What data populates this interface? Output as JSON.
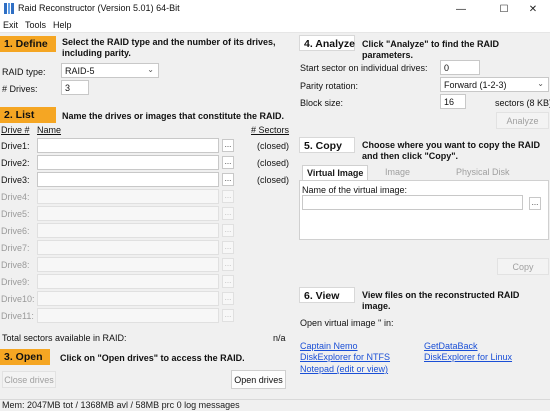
{
  "window": {
    "title": "Raid Reconstructor (Version 5.01) 64-Bit",
    "minimize": "—",
    "maximize": "☐",
    "close": "✕"
  },
  "menu": [
    "Exit",
    "Tools",
    "Help"
  ],
  "define": {
    "badge": "1. Define",
    "description": "Select the RAID type and the number of its drives, including parity.",
    "raid_type_label": "RAID type:",
    "raid_type_value": "RAID-5",
    "drives_label": "# Drives:",
    "drives_value": "3"
  },
  "list": {
    "badge": "2. List",
    "description": "Name the drives or images that constitute the RAID.",
    "col_drive": "Drive #",
    "col_name": "Name",
    "col_sectors": "# Sectors",
    "browse_label": "...",
    "drives": [
      {
        "label": "Drive1:",
        "value": "",
        "status": "(closed)",
        "enabled": true
      },
      {
        "label": "Drive2:",
        "value": "",
        "status": "(closed)",
        "enabled": true
      },
      {
        "label": "Drive3:",
        "value": "",
        "status": "(closed)",
        "enabled": true
      },
      {
        "label": "Drive4:",
        "value": "",
        "status": "",
        "enabled": false
      },
      {
        "label": "Drive5:",
        "value": "",
        "status": "",
        "enabled": false
      },
      {
        "label": "Drive6:",
        "value": "",
        "status": "",
        "enabled": false
      },
      {
        "label": "Drive7:",
        "value": "",
        "status": "",
        "enabled": false
      },
      {
        "label": "Drive8:",
        "value": "",
        "status": "",
        "enabled": false
      },
      {
        "label": "Drive9:",
        "value": "",
        "status": "",
        "enabled": false
      },
      {
        "label": "Drive10:",
        "value": "",
        "status": "",
        "enabled": false
      },
      {
        "label": "Drive11:",
        "value": "",
        "status": "",
        "enabled": false
      }
    ],
    "total_label": "Total sectors available in RAID:",
    "total_value": "n/a"
  },
  "open": {
    "badge": "3. Open",
    "description": "Click on \"Open drives\" to access the RAID.",
    "close_button": "Close drives",
    "open_button": "Open drives"
  },
  "analyze": {
    "badge": "4. Analyze",
    "description": "Click \"Analyze\" to find the RAID parameters.",
    "start_sector_label": "Start sector on individual drives:",
    "start_sector_value": "0",
    "parity_label": "Parity rotation:",
    "parity_value": "Forward (1-2-3)",
    "block_label": "Block size:",
    "block_value": "16",
    "block_unit": "sectors (8 KB)",
    "analyze_button": "Analyze"
  },
  "copy": {
    "badge": "5. Copy",
    "description": "Choose where you want to copy the RAID and then click \"Copy\".",
    "tabs": [
      "Virtual Image",
      "Image",
      "Physical Disk"
    ],
    "name_label": "Name of the virtual image:",
    "name_value": "",
    "browse_label": "...",
    "copy_button": "Copy"
  },
  "view": {
    "badge": "6. View",
    "description": "View files on the reconstructed RAID image.",
    "open_label": "Open virtual image '' in:",
    "links": [
      "Captain Nemo",
      "GetDataBack",
      "DiskExplorer for NTFS",
      "DiskExplorer for Linux",
      "Notepad (edit or view)"
    ]
  },
  "status": {
    "text": "Mem: 2047MB tot / 1368MB avl / 58MB prc 0 log messages"
  },
  "colors": {
    "section_badge": "#f5a623",
    "link": "#1a4fd6"
  }
}
